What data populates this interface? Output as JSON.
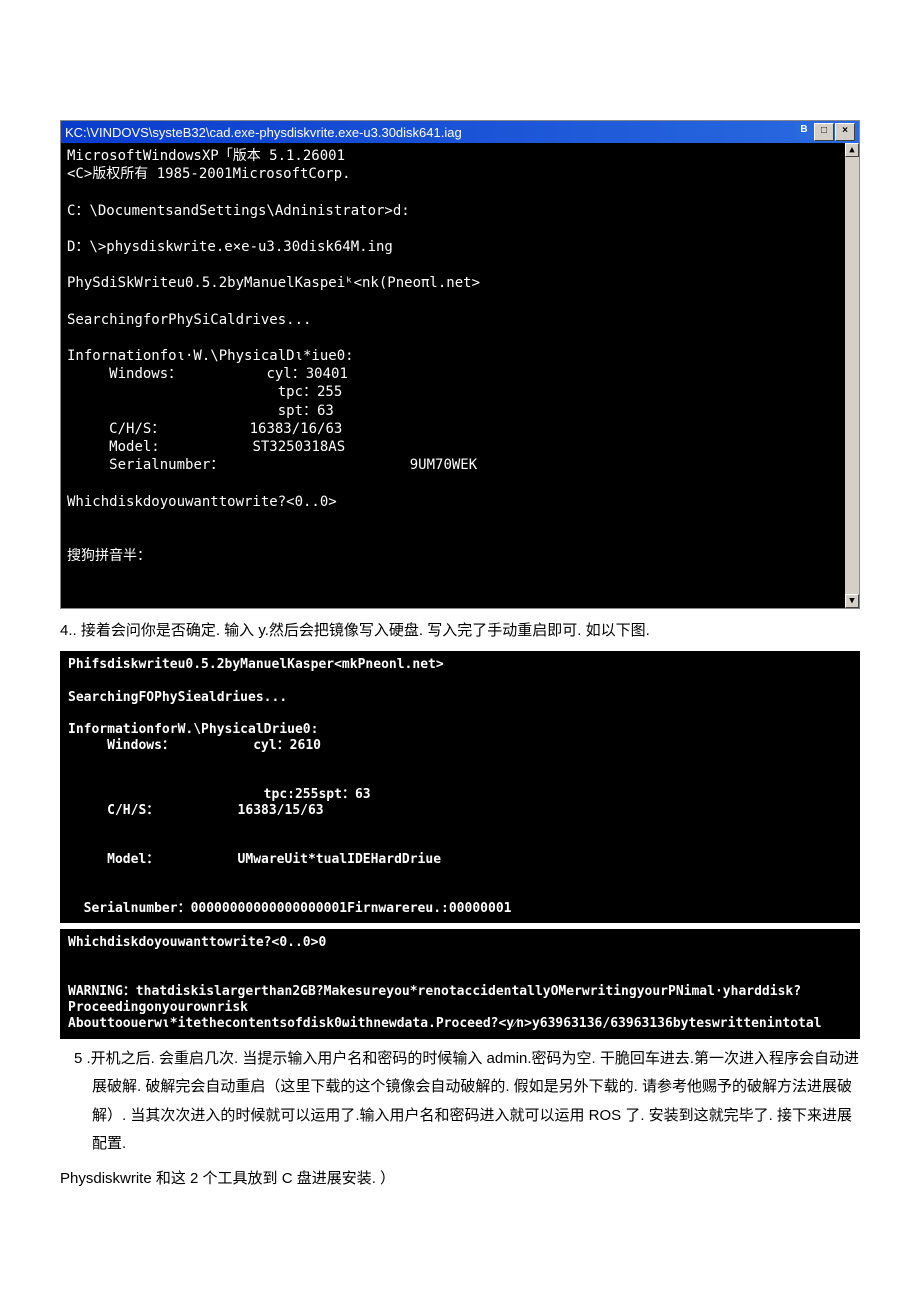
{
  "window1": {
    "title": "KC:\\VINDOVS\\systeB32\\cad.exe-physdiskvrite.exe-u3.30disk641.iag",
    "min_button": "B",
    "max_button": "□",
    "close_button": "×",
    "scroll_up": "▲",
    "scroll_down": "▼",
    "body": "MicrosoftWindowsXP「版本 5.1.26001\n<C>版权所有 1985-2001MicrosoftCorp.\n\nC：\\DocumentsandSettings\\Adninistrator>d:\n\nD：\\>physdiskwrite.e×e-u3.30disk64M.ing\n\nPhySdiSkWriteu0.5.2byManuelKaspeiᵏ<nk(Pneoπl.net>\n\nSearchingforPhySiCaldrives...\n\nInfornationfoι·W.\\PhysicalDι*iue0:\n     Windows：          cyl：30401\n                         tpc：255\n                         spt：63\n     C/H/S：          16383/16/63\n     Model:           ST3250318AS\n     Serialnumber：                      9UM70WEK\n\nWhichdiskdoyouwanttowrite?<0..0>\n\n\n搜狗拼音半："
  },
  "para4": "4.. 接着会问你是否确定. 输入 y.然后会把镜像写入硬盘. 写入完了手动重启即可. 如以下图.",
  "block2a": "Phifsdiskwriteu0.5.2byManuelKasper<mkPneonl.net>\n\nSearchingFOPhySiealdriues...\n\nInformationforW.\\PhysicalDriue0:\n     Windows：          cyl：2610\n\n\n                         tpc:255spt：63\n     C/H/S：          16383/15/63\n\n\n     Model：          UMwareUit*tualIDEHardDriue\n\n\n  Serialnumber：00000000000000000001Firnwarereu.:00000001",
  "block2b": "Whichdiskdoyouwanttowrite?<0..0>0\n\n\nWARNING：thatdiskislargerthan2GB?Makesureyou*renotaccidentallyOMerwritingyourPNimal·yharddisk?Proceedingonyourownrisk\nAbouttoouerwι*itethecontentsofdisk0ωithnewdata.Proceed?<y⁄n>y63963136/63963136byteswrittenintotal\n",
  "para5": "5  .开机之后. 会重启几次. 当提示输入用户名和密码的时候输入 admin.密码为空. 干脆回车进去.第一次进入程序会自动进展破解. 破解完会自动重启（这里下载的这个镜像会自动破解的. 假如是另外下载的. 请参考他赐予的破解方法进展破解）. 当其次次进入的时候就可以运用了.输入用户名和密码进入就可以运用 ROS 了. 安装到这就完毕了. 接下来进展配置.",
  "para6": "Physdiskwrite 和这 2 个工具放到 C 盘进展安装. ）"
}
